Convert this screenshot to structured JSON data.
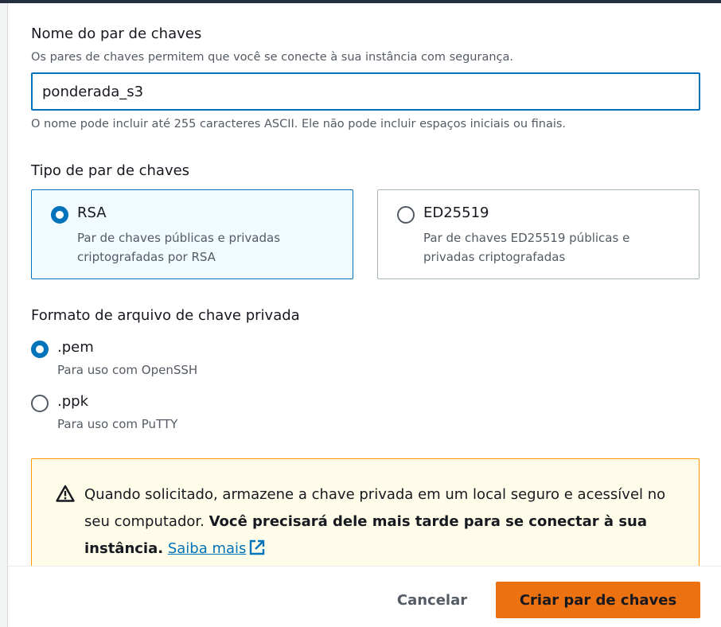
{
  "key_pair_name": {
    "label": "Nome do par de chaves",
    "description": "Os pares de chaves permitem que você se conecte à sua instância com segurança.",
    "value": "ponderada_s3",
    "constraint": "O nome pode incluir até 255 caracteres ASCII. Ele não pode incluir espaços iniciais ou finais."
  },
  "key_pair_type": {
    "label": "Tipo de par de chaves",
    "options": [
      {
        "title": "RSA",
        "description": "Par de chaves públicas e privadas criptografadas por RSA",
        "selected": true
      },
      {
        "title": "ED25519",
        "description": "Par de chaves ED25519 públicas e privadas criptografadas",
        "selected": false
      }
    ]
  },
  "private_key_format": {
    "label": "Formato de arquivo de chave privada",
    "options": [
      {
        "title": ".pem",
        "description": "Para uso com OpenSSH",
        "selected": true
      },
      {
        "title": ".ppk",
        "description": "Para uso com PuTTY",
        "selected": false
      }
    ]
  },
  "alert": {
    "icon": "warning-icon",
    "text_before": "Quando solicitado, armazene a chave privada em um local seguro e acessível no seu computador.",
    "text_bold": "Você precisará dele mais tarde para se conectar à sua instância.",
    "link_label": "Saiba mais",
    "link_icon": "external-link-icon"
  },
  "footer": {
    "cancel_label": "Cancelar",
    "create_label": "Criar par de chaves"
  },
  "colors": {
    "accent": "#0073bb",
    "primary_button": "#ec7211",
    "warning_border": "#ff9900",
    "warning_bg": "#fffce9"
  }
}
